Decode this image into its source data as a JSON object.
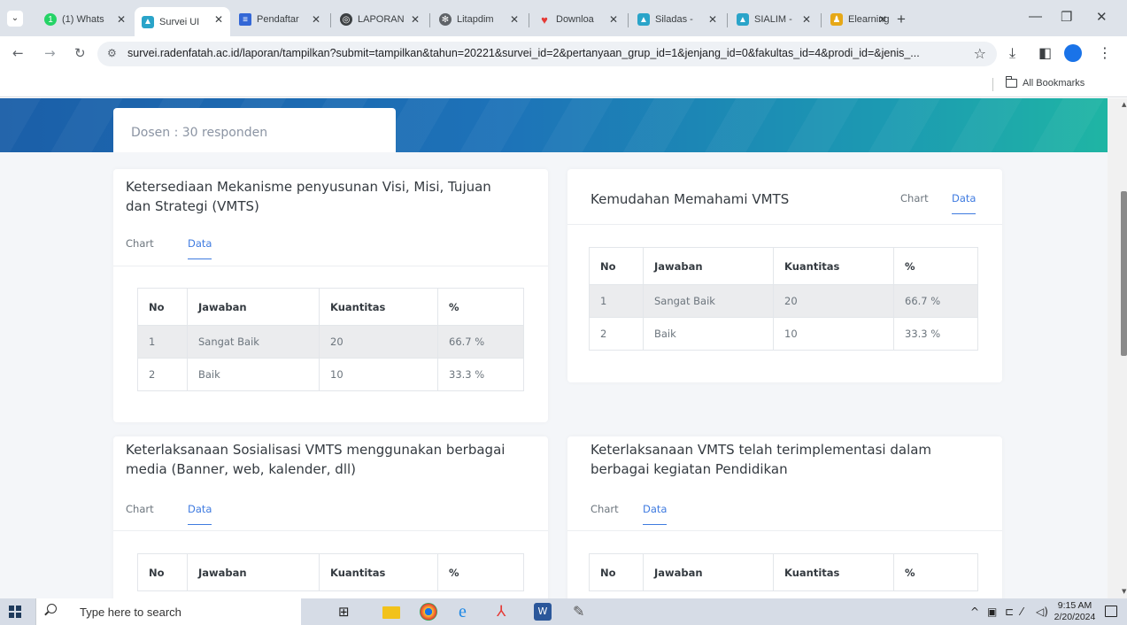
{
  "browser": {
    "tabs": [
      {
        "label": "(1) Whats",
        "icon": "whatsapp-icon",
        "color": "#25d366"
      },
      {
        "label": "Survei UI",
        "icon": "university-icon",
        "color": "#2aa4c9",
        "active": true
      },
      {
        "label": "Pendaftar",
        "icon": "forms-icon",
        "color": "#3367d6"
      },
      {
        "label": "LAPORAN",
        "icon": "globe-icon",
        "color": "#3c4043"
      },
      {
        "label": "Litapdim",
        "icon": "settings-icon",
        "color": "#5f6368"
      },
      {
        "label": "Downloa",
        "icon": "heart-icon",
        "color": "#e53935"
      },
      {
        "label": "Siladas -",
        "icon": "university-icon",
        "color": "#2aa4c9"
      },
      {
        "label": "SIALIM -",
        "icon": "university-icon",
        "color": "#2aa4c9"
      },
      {
        "label": "Elearning",
        "icon": "elearning-icon",
        "color": "#e6a817"
      }
    ],
    "new_tab": "+",
    "url": "survei.radenfatah.ac.id/laporan/tampilkan?submit=tampilkan&tahun=20221&survei_id=2&pertanyaan_grup_id=1&jenjang_id=0&fakultas_id=4&prodi_id=&jenis_...",
    "bookmarks_label": "All Bookmarks"
  },
  "page": {
    "respondents": "Dosen : 30 responden",
    "tab_chart": "Chart",
    "tab_data": "Data",
    "table_headers": [
      "No",
      "Jawaban",
      "Kuantitas",
      "%"
    ],
    "cards": [
      {
        "title": "Ketersediaan Mekanisme penyusunan Visi, Misi, Tujuan dan Strategi (VMTS)",
        "rows": [
          [
            "1",
            "Sangat Baik",
            "20",
            "66.7 %"
          ],
          [
            "2",
            "Baik",
            "10",
            "33.3 %"
          ]
        ]
      },
      {
        "title": "Kemudahan Memahami VMTS",
        "rows": [
          [
            "1",
            "Sangat Baik",
            "20",
            "66.7 %"
          ],
          [
            "2",
            "Baik",
            "10",
            "33.3 %"
          ]
        ]
      },
      {
        "title": "Keterlaksanaan Sosialisasi VMTS menggunakan berbagai media (Banner, web, kalender, dll)",
        "rows": []
      },
      {
        "title": "Keterlaksanaan VMTS telah terimplementasi dalam berbagai kegiatan Pendidikan",
        "rows": []
      }
    ]
  },
  "taskbar": {
    "search_placeholder": "Type here to search",
    "time": "9:15 AM",
    "date": "2/20/2024"
  }
}
